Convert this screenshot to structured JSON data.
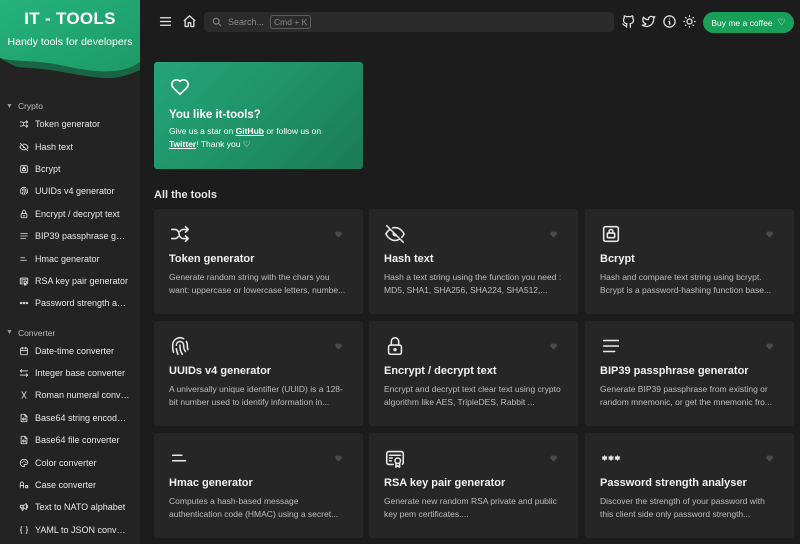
{
  "brand": {
    "title": "IT - TOOLS",
    "subtitle": "Handy tools for developers"
  },
  "sidebar": {
    "sections": [
      {
        "label": "Crypto",
        "items": [
          {
            "label": "Token generator",
            "icon": "shuffle-icon"
          },
          {
            "label": "Hash text",
            "icon": "eye-off-icon"
          },
          {
            "label": "Bcrypt",
            "icon": "lock-square-icon"
          },
          {
            "label": "UUIDs v4 generator",
            "icon": "fingerprint-icon"
          },
          {
            "label": "Encrypt / decrypt text",
            "icon": "lock-icon"
          },
          {
            "label": "BIP39 passphrase gen...",
            "icon": "align-justified-icon"
          },
          {
            "label": "Hmac generator",
            "icon": "short-text-icon"
          },
          {
            "label": "RSA key pair generator",
            "icon": "certificate-icon"
          },
          {
            "label": "Password strength ana...",
            "icon": "password-icon"
          }
        ]
      },
      {
        "label": "Converter",
        "items": [
          {
            "label": "Date-time converter",
            "icon": "calendar-icon"
          },
          {
            "label": "Integer base converter",
            "icon": "arrows-left-right-icon"
          },
          {
            "label": "Roman numeral conver...",
            "icon": "letter-x-icon"
          },
          {
            "label": "Base64 string encoder...",
            "icon": "file-digit-icon"
          },
          {
            "label": "Base64 file converter",
            "icon": "file-digit-icon"
          },
          {
            "label": "Color converter",
            "icon": "palette-icon"
          },
          {
            "label": "Case converter",
            "icon": "letter-case-icon"
          },
          {
            "label": "Text to NATO alphabet",
            "icon": "speakerphone-icon"
          },
          {
            "label": "YAML to JSON convert...",
            "icon": "braces-icon"
          }
        ]
      }
    ]
  },
  "topbar": {
    "search_placeholder": "Search...",
    "search_shortcut": "Cmd + K",
    "coffee_label": "Buy me a coffee",
    "coffee_icon": "heart-icon"
  },
  "hero": {
    "title": "You like it-tools?",
    "text_1": "Give us a star on ",
    "link_github": "GitHub",
    "text_2": " or follow us on",
    "link_twitter": "Twitter",
    "text_3": "! Thank you ♡"
  },
  "section_title": "All the tools",
  "tools": [
    {
      "title": "Token generator",
      "desc": "Generate random string with the chars you want: uppercase or lowercase letters, numbe...",
      "icon": "shuffle-icon"
    },
    {
      "title": "Hash text",
      "desc": "Hash a text string using the function you need : MD5, SHA1, SHA256, SHA224, SHA512,...",
      "icon": "eye-off-icon"
    },
    {
      "title": "Bcrypt",
      "desc": "Hash and compare text string using bcrypt. Bcrypt is a password-hashing function base...",
      "icon": "lock-square-icon"
    },
    {
      "title": "UUIDs v4 generator",
      "desc": "A universally unique identifier (UUID) is a 128-bit number used to identify information in...",
      "icon": "fingerprint-icon"
    },
    {
      "title": "Encrypt / decrypt text",
      "desc": "Encrypt and decrypt text clear text using crypto algorithm like AES, TripleDES, Rabbit ...",
      "icon": "lock-icon"
    },
    {
      "title": "BIP39 passphrase generator",
      "desc": "Generate BIP39 passphrase from existing or random mnemonic, or get the mnemonic fro...",
      "icon": "align-justified-icon"
    },
    {
      "title": "Hmac generator",
      "desc": "Computes a hash-based message authentication code (HMAC) using a secret...",
      "icon": "short-text-icon"
    },
    {
      "title": "RSA key pair generator",
      "desc": "Generate new random RSA private and public key pem certificates....",
      "icon": "certificate-icon"
    },
    {
      "title": "Password strength analyser",
      "desc": "Discover the strength of your password with this client side only password strength...",
      "icon": "password-icon"
    }
  ],
  "colors": {
    "accent": "#18a058",
    "background": "#1c1c1c",
    "card": "#262626",
    "sidebar": "#232323"
  }
}
